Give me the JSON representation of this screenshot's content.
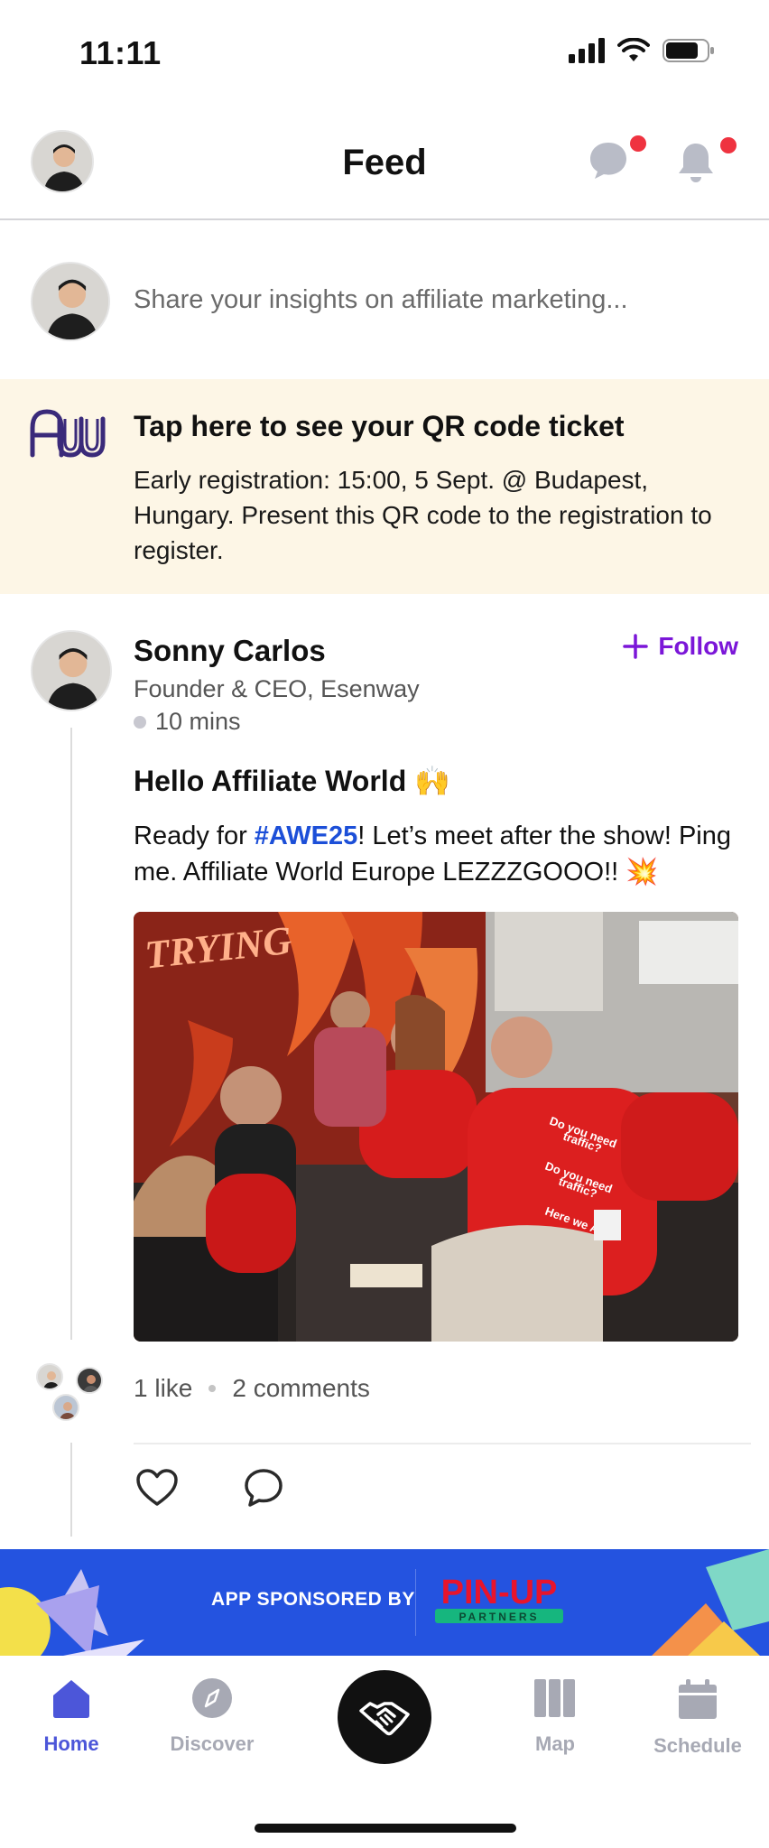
{
  "status_bar": {
    "time": "11:11",
    "battery_level": 0.8
  },
  "header": {
    "title": "Feed",
    "has_message_notification": true,
    "has_bell_notification": true,
    "accent_colors": {
      "notification_dot": "#ef3340"
    }
  },
  "composer": {
    "placeholder": "Share your insights on affiliate marketing..."
  },
  "ticket": {
    "logo_text": "AW",
    "title": "Tap here to see your QR code ticket",
    "body": "Early registration: 15:00, 5 Sept. @ Budapest, Hungary. Present this QR code to the registration to register.",
    "background_color": "#fdf6e6",
    "logo_color": "#3a2a7a"
  },
  "post": {
    "author_name": "Sonny Carlos",
    "author_role": "Founder & CEO, Esenway",
    "time_ago": "10 mins",
    "follow_label": "Follow",
    "follow_color": "#7b16d8",
    "title": "Hello Affiliate World",
    "title_emoji": "🙌",
    "body_prefix": "Ready for ",
    "hashtag": "#AWE25",
    "body_suffix": "! Let’s meet after the show! Ping me. Affiliate World Europe LEZZZGOOO!! ",
    "body_emoji": "💥",
    "image_text": "TRYING",
    "shirt_text": [
      "Do you need",
      "traffic?",
      "Do you need",
      "traffic?",
      "Here we Are"
    ],
    "likes_label": "1 like",
    "comments_label": "2 comments"
  },
  "sponsor": {
    "label": "APP SPONSORED BY",
    "brand_name": "PIN-UP",
    "brand_sub": "PARTNERS",
    "background_color": "#2453e0"
  },
  "tabbar": {
    "tabs": [
      {
        "label": "Home",
        "icon": "home-icon",
        "active": true
      },
      {
        "label": "Discover",
        "icon": "compass-icon",
        "active": false
      },
      {
        "label": "Map",
        "icon": "map-icon",
        "active": false
      },
      {
        "label": "Schedule",
        "icon": "calendar-icon",
        "active": false
      }
    ],
    "center_icon": "handshake-icon",
    "active_color": "#4c56d9",
    "inactive_color": "#a7a9b4"
  }
}
